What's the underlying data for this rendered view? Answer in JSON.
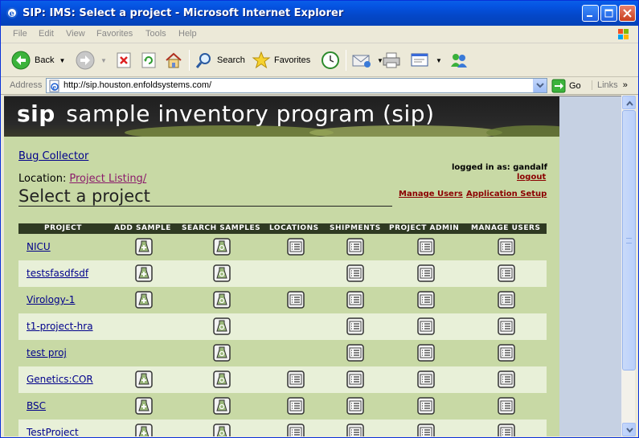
{
  "window": {
    "title": "SIP: IMS: Select a project - Microsoft Internet Explorer"
  },
  "menu": [
    "File",
    "Edit",
    "View",
    "Favorites",
    "Tools",
    "Help"
  ],
  "toolbar": {
    "back_label": "Back",
    "search_label": "Search",
    "favorites_label": "Favorites"
  },
  "address": {
    "label": "Address",
    "url": "http://sip.houston.enfoldsystems.com/",
    "go_label": "Go",
    "links_label": "Links"
  },
  "banner": {
    "short": "sip",
    "title": "sample inventory program (sip)"
  },
  "page": {
    "bug_collector": "Bug Collector",
    "location_label": "Location:",
    "location_link": "Project Listing/",
    "heading": "Select a project",
    "logged_in": "logged in as: gandalf",
    "logout": "logout",
    "manage_users": "Manage Users",
    "app_setup": "Application Setup"
  },
  "table": {
    "headers": [
      "PROJECT",
      "ADD SAMPLE",
      "SEARCH SAMPLES",
      "LOCATIONS",
      "SHIPMENTS",
      "PROJECT ADMIN",
      "MANAGE USERS"
    ],
    "rows": [
      {
        "name": "NICU",
        "add": true,
        "search": true,
        "locations": true,
        "shipments": true,
        "admin": true,
        "users": true
      },
      {
        "name": "testsfasdfsdf",
        "add": true,
        "search": true,
        "locations": false,
        "shipments": true,
        "admin": true,
        "users": true
      },
      {
        "name": "Virology-1",
        "add": true,
        "search": true,
        "locations": true,
        "shipments": true,
        "admin": true,
        "users": true
      },
      {
        "name": "t1-project-hra",
        "add": false,
        "search": true,
        "locations": false,
        "shipments": true,
        "admin": true,
        "users": true
      },
      {
        "name": "test proj",
        "add": false,
        "search": true,
        "locations": false,
        "shipments": true,
        "admin": true,
        "users": true
      },
      {
        "name": "Genetics:COR",
        "add": true,
        "search": true,
        "locations": true,
        "shipments": true,
        "admin": true,
        "users": true
      },
      {
        "name": "BSC",
        "add": true,
        "search": true,
        "locations": true,
        "shipments": true,
        "admin": true,
        "users": true
      },
      {
        "name": "TestProject",
        "add": true,
        "search": true,
        "locations": true,
        "shipments": true,
        "admin": true,
        "users": true
      }
    ]
  },
  "colors": {
    "content_bg": "#c8d9a5",
    "row_alt": "#e8f0d8",
    "header_bg": "#2f3a22",
    "link": "#00008b",
    "admin_link": "#8b0000"
  }
}
